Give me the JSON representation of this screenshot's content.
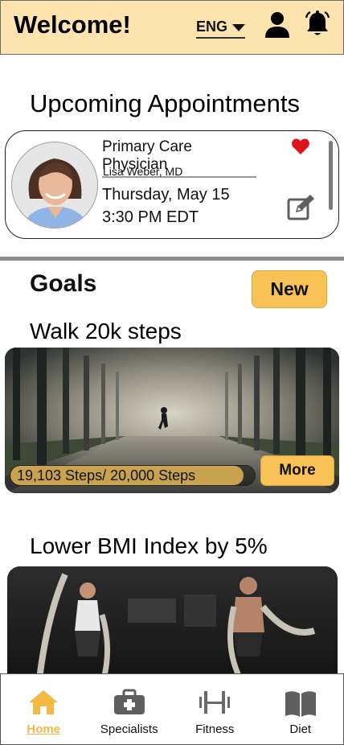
{
  "header": {
    "title": "Welcome!",
    "language": "ENG"
  },
  "appointments": {
    "heading": "Upcoming Appointments",
    "card": {
      "specialty": "Primary Care Physician",
      "doctor": "Lisa Weber, MD",
      "date": "Thursday, May 15",
      "time": "3:30 PM EDT"
    }
  },
  "goals": {
    "heading": "Goals",
    "new_label": "New",
    "items": [
      {
        "title": "Walk 20k steps",
        "progress_text": "19,103 Steps/ 20,000 Steps",
        "progress_fraction": 0.955,
        "more_label": "More"
      },
      {
        "title": "Lower BMI Index by 5%"
      }
    ]
  },
  "nav": {
    "items": [
      {
        "label": "Home",
        "icon": "home-icon",
        "active": true
      },
      {
        "label": "Specialists",
        "icon": "medical-kit-icon",
        "active": false
      },
      {
        "label": "Fitness",
        "icon": "dumbbell-icon",
        "active": false
      },
      {
        "label": "Diet",
        "icon": "book-icon",
        "active": false
      }
    ]
  },
  "colors": {
    "header_bg": "#fde3ae",
    "accent": "#f8c257",
    "active_nav": "#f5b946",
    "heart": "#e0121c",
    "icon_gray": "#5f5f5f"
  }
}
